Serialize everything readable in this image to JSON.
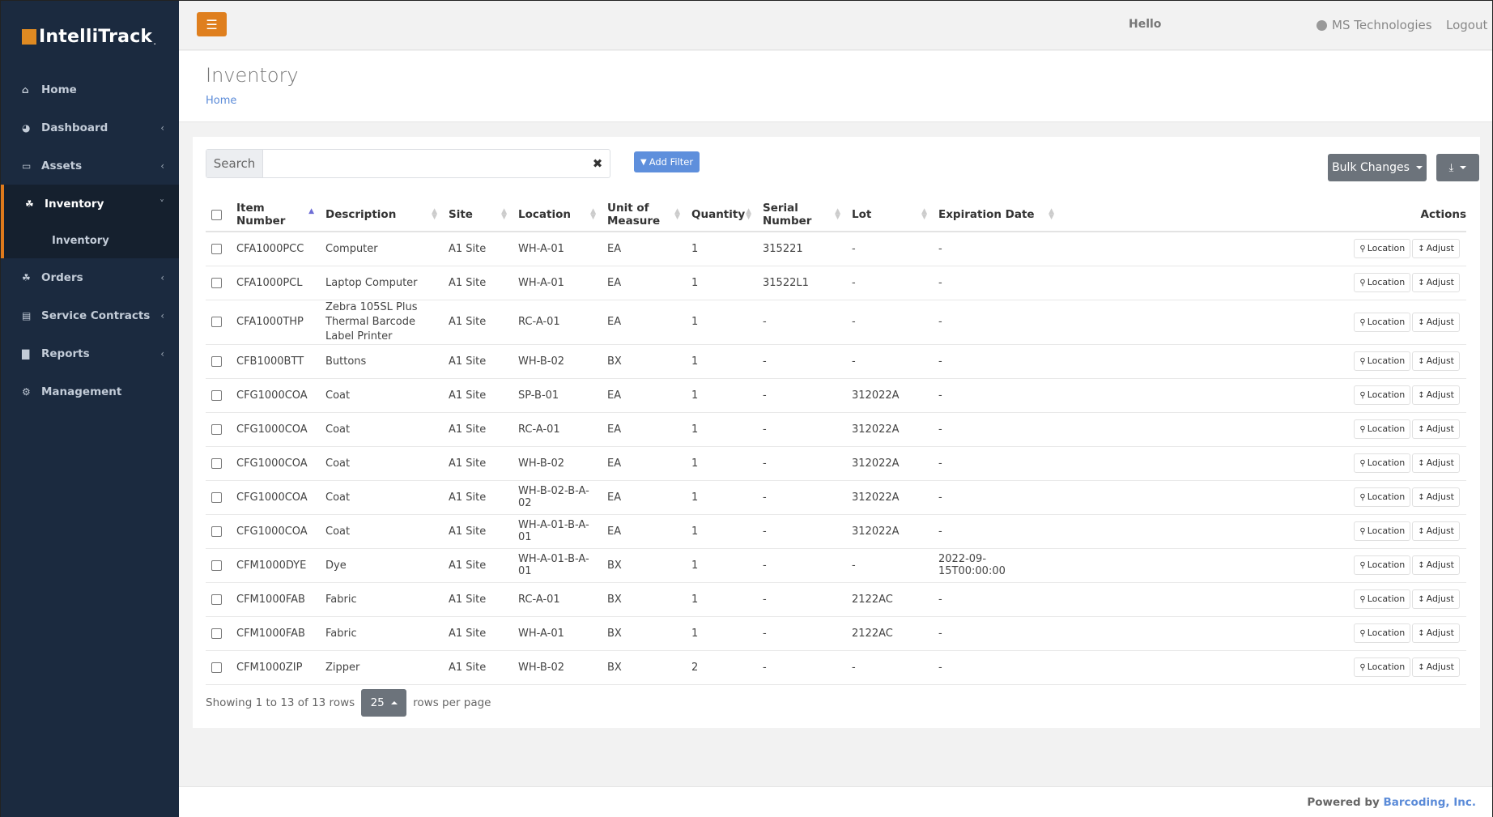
{
  "app": {
    "logo_text": "IntelliTrack",
    "logo_dot": ".",
    "brand_color": "#df8a22"
  },
  "sidebar": {
    "items": [
      {
        "label": "Home",
        "icon": "home-icon",
        "has_chevron": false
      },
      {
        "label": "Dashboard",
        "icon": "dashboard-icon",
        "has_chevron": true
      },
      {
        "label": "Assets",
        "icon": "laptop-icon",
        "has_chevron": true
      },
      {
        "label": "Inventory",
        "icon": "cubes-icon",
        "has_chevron": true,
        "active": true,
        "subitems": [
          {
            "label": "Inventory"
          }
        ]
      },
      {
        "label": "Orders",
        "icon": "cubes-icon",
        "has_chevron": true
      },
      {
        "label": "Service Contracts",
        "icon": "book-icon",
        "has_chevron": true
      },
      {
        "label": "Reports",
        "icon": "bar-chart-icon",
        "has_chevron": true
      },
      {
        "label": "Management",
        "icon": "cogs-icon",
        "has_chevron": false
      }
    ]
  },
  "topbar": {
    "greeting": "Hello",
    "organization": "MS Technologies",
    "logout": "Logout"
  },
  "page": {
    "title": "Inventory",
    "breadcrumb": "Home"
  },
  "toolbar": {
    "search_label": "Search",
    "search_value": "",
    "search_placeholder": "",
    "add_filter": "Add Filter",
    "bulk_changes": "Bulk Changes"
  },
  "table": {
    "columns": [
      "Item Number",
      "Description",
      "Site",
      "Location",
      "Unit of Measure",
      "Quantity",
      "Serial Number",
      "Lot",
      "Expiration Date",
      "Actions"
    ],
    "sorted_column": "Item Number",
    "sort_direction": "asc",
    "action_labels": {
      "location": "Location",
      "adjust": "Adjust"
    },
    "rows": [
      [
        "CFA1000PCC",
        "Computer",
        "A1 Site",
        "WH-A-01",
        "EA",
        "1",
        "315221",
        "-",
        "-"
      ],
      [
        "CFA1000PCL",
        "Laptop Computer",
        "A1 Site",
        "WH-A-01",
        "EA",
        "1",
        "31522L1",
        "-",
        "-"
      ],
      [
        "CFA1000THP",
        "Zebra 105SL Plus Thermal Barcode Label Printer",
        "A1 Site",
        "RC-A-01",
        "EA",
        "1",
        "-",
        "-",
        "-"
      ],
      [
        "CFB1000BTT",
        "Buttons",
        "A1 Site",
        "WH-B-02",
        "BX",
        "1",
        "-",
        "-",
        "-"
      ],
      [
        "CFG1000COA",
        "Coat",
        "A1 Site",
        "SP-B-01",
        "EA",
        "1",
        "-",
        "312022A",
        "-"
      ],
      [
        "CFG1000COA",
        "Coat",
        "A1 Site",
        "RC-A-01",
        "EA",
        "1",
        "-",
        "312022A",
        "-"
      ],
      [
        "CFG1000COA",
        "Coat",
        "A1 Site",
        "WH-B-02",
        "EA",
        "1",
        "-",
        "312022A",
        "-"
      ],
      [
        "CFG1000COA",
        "Coat",
        "A1 Site",
        "WH-B-02-B-A-02",
        "EA",
        "1",
        "-",
        "312022A",
        "-"
      ],
      [
        "CFG1000COA",
        "Coat",
        "A1 Site",
        "WH-A-01-B-A-01",
        "EA",
        "1",
        "-",
        "312022A",
        "-"
      ],
      [
        "CFM1000DYE",
        "Dye",
        "A1 Site",
        "WH-A-01-B-A-01",
        "BX",
        "1",
        "-",
        "-",
        "2022-09-15T00:00:00"
      ],
      [
        "CFM1000FAB",
        "Fabric",
        "A1 Site",
        "RC-A-01",
        "BX",
        "1",
        "-",
        "2122AC",
        "-"
      ],
      [
        "CFM1000FAB",
        "Fabric",
        "A1 Site",
        "WH-A-01",
        "BX",
        "1",
        "-",
        "2122AC",
        "-"
      ],
      [
        "CFM1000ZIP",
        "Zipper",
        "A1 Site",
        "WH-B-02",
        "BX",
        "2",
        "-",
        "-",
        "-"
      ]
    ]
  },
  "pagination": {
    "info": "Showing 1 to 13 of 13 rows",
    "page_size": "25",
    "suffix": "rows per page"
  },
  "footer": {
    "prefix": "Powered by",
    "link": "Barcoding, Inc."
  }
}
